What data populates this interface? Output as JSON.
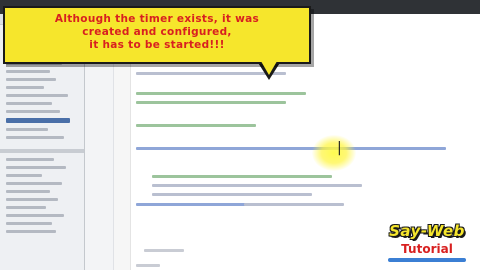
{
  "callout": {
    "text": "Although the timer exists, it was\ncreated and configured,\nit has to be started!!!"
  },
  "logo": {
    "top": "Say-Web",
    "bottom": "Tutorial",
    "colors": {
      "yellow": "#f6e62c",
      "red": "#d82020",
      "blue": "#3b7fd4"
    }
  },
  "colors": {
    "callout_bg": "#f6e62c",
    "callout_text": "#d82020",
    "code_comment": "#6aa06a",
    "code_keyword": "#3a5fc8"
  }
}
